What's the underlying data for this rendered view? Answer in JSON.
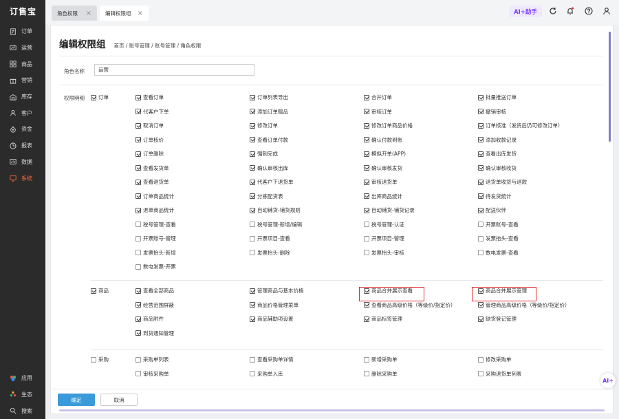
{
  "app": {
    "logo": "订售宝"
  },
  "sidebar": {
    "items": [
      {
        "label": "订单",
        "icon": "order-icon"
      },
      {
        "label": "运营",
        "icon": "operation-icon"
      },
      {
        "label": "商品",
        "icon": "goods-icon"
      },
      {
        "label": "营销",
        "icon": "marketing-icon"
      },
      {
        "label": "库存",
        "icon": "warehouse-icon"
      },
      {
        "label": "客户",
        "icon": "customer-icon"
      },
      {
        "label": "资金",
        "icon": "money-icon"
      },
      {
        "label": "报表",
        "icon": "report-icon"
      },
      {
        "label": "数据",
        "icon": "data-icon"
      },
      {
        "label": "系统",
        "icon": "system-icon",
        "active": true
      }
    ],
    "bottom": [
      {
        "label": "应用",
        "icon": "apps-icon"
      },
      {
        "label": "生态",
        "icon": "ecosystem-icon"
      },
      {
        "label": "搜索",
        "icon": "search-icon"
      }
    ]
  },
  "tabs": [
    {
      "label": "角色权限"
    },
    {
      "label": "编辑权限组"
    }
  ],
  "topbar": {
    "ai_label": "AI+助手"
  },
  "page": {
    "title": "编辑权限组",
    "breadcrumb": "首页 / 账号管理 / 账号管理 / 角色权限",
    "role_name_label": "角色名称",
    "role_name_value": "运营",
    "perm_detail_label": "权限明细"
  },
  "groups": [
    {
      "name": "订单",
      "checked": true,
      "items": [
        [
          "查看订单",
          true
        ],
        [
          "订单列表导出",
          true
        ],
        [
          "合并订单",
          true
        ],
        [
          "批量推送订单",
          true
        ],
        [
          "代客户下单",
          true
        ],
        [
          "添加订单赠品",
          true
        ],
        [
          "审核订单",
          true
        ],
        [
          "撤销审核",
          true
        ],
        [
          "取消订单",
          true
        ],
        [
          "修改订单",
          true
        ],
        [
          "修改订单商品价格",
          true
        ],
        [
          "订单核准（发货后仍可修改订单）",
          true
        ],
        [
          "订单核价",
          true
        ],
        [
          "查看订单付款",
          true
        ],
        [
          "确认付款到账",
          true
        ],
        [
          "添加收款记录",
          true
        ],
        [
          "订单删除",
          true
        ],
        [
          "强制完成",
          true
        ],
        [
          "模拟开单(APP)",
          true
        ],
        [
          "查看出库发货",
          true
        ],
        [
          "查看发货单",
          true
        ],
        [
          "确认审核出库",
          true
        ],
        [
          "确认审核发货",
          true
        ],
        [
          "确认审核收货",
          true
        ],
        [
          "查看退货单",
          true
        ],
        [
          "代客户下退货单",
          true
        ],
        [
          "审核退货单",
          true
        ],
        [
          "退货单收货与退款",
          true
        ],
        [
          "订单商品统计",
          true
        ],
        [
          "分拣配货表",
          true
        ],
        [
          "出库商品统计",
          true
        ],
        [
          "待发货统计",
          true
        ],
        [
          "退单商品统计",
          true
        ],
        [
          "自动铺货-铺货规则",
          true
        ],
        [
          "自动铺货-铺货记录",
          true
        ],
        [
          "配送伙伴",
          true
        ],
        [
          "税号管理-查看",
          false
        ],
        [
          "税号管理-新增/编辑",
          false
        ],
        [
          "税号管理-认证",
          false
        ],
        [
          "开票账号-查看",
          false
        ],
        [
          "开票账号-管理",
          false
        ],
        [
          "开票项目-查看",
          false
        ],
        [
          "开票项目-管理",
          false
        ],
        [
          "发票抬头-查看",
          false
        ],
        [
          "发票抬头-新增",
          false
        ],
        [
          "发票抬头-删除",
          false
        ],
        [
          "发票抬头-审核",
          false
        ],
        [
          "数电发票-查看",
          false
        ],
        [
          "数电发票-开票",
          false
        ]
      ]
    },
    {
      "name": "商品",
      "checked": true,
      "items": [
        [
          "查看全部商品",
          true
        ],
        [
          "管理商品与基本价格",
          true
        ],
        [
          "商品合并展示查看",
          true
        ],
        [
          "商品合并展示管理",
          true
        ],
        [
          "经营范围屏蔽",
          true
        ],
        [
          "商品价格管理菜单",
          true
        ],
        [
          "查看商品高级价格（等级价/指定价）",
          true
        ],
        [
          "管理商品高级价格（等级价/指定价）",
          true
        ],
        [
          "商品附件",
          true
        ],
        [
          "商品辅助项设置",
          true
        ],
        [
          "商品标签管理",
          true
        ],
        [
          "缺货登记管理",
          true
        ],
        [
          "到货通知管理",
          true
        ]
      ]
    },
    {
      "name": "采购",
      "checked": false,
      "items": [
        [
          "采购单列表",
          false
        ],
        [
          "查看采购单详情",
          false
        ],
        [
          "新增采购单",
          false
        ],
        [
          "修改采购单",
          false
        ],
        [
          "审核采购单",
          false
        ],
        [
          "采购单入库",
          false
        ],
        [
          "删除采购单",
          false
        ],
        [
          "采购退货单列表",
          false
        ]
      ]
    }
  ],
  "footer": {
    "ok_label": "确定",
    "cancel_label": "取消"
  }
}
